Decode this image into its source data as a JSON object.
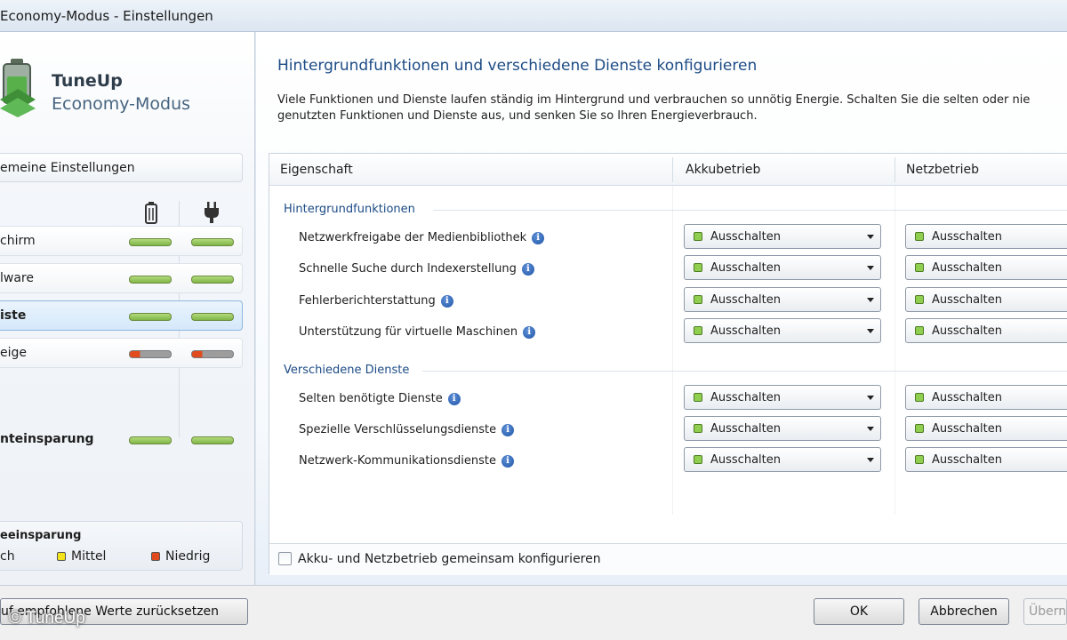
{
  "window": {
    "title": "Economy-Modus - Einstellungen"
  },
  "brand": {
    "name": "TuneUp",
    "subtitle": "Economy-Modus",
    "icon": "battery-logo-icon"
  },
  "sidebar": {
    "header": "emeine Einstellungen",
    "column_icons": [
      "battery-icon",
      "plug-icon"
    ],
    "items": [
      {
        "label": "chirm",
        "battery_level": "high",
        "ac_level": "high",
        "selected": false
      },
      {
        "label": "lware",
        "battery_level": "high",
        "ac_level": "high",
        "selected": false
      },
      {
        "label": "iste",
        "battery_level": "high",
        "ac_level": "high",
        "selected": true
      },
      {
        "label": "eige",
        "battery_level": "low",
        "ac_level": "low",
        "selected": false
      }
    ],
    "summary": {
      "label": "nteinsparung",
      "battery_level": "high",
      "ac_level": "high"
    },
    "legend": {
      "title": "eeinsparung",
      "items": [
        {
          "label": "ch",
          "color": "#7cc242"
        },
        {
          "label": "Mittel",
          "color": "#f2e31b"
        },
        {
          "label": "Niedrig",
          "color": "#e24b1d"
        }
      ]
    }
  },
  "main": {
    "title": "Hintergrundfunktionen und verschiedene Dienste konfigurieren",
    "description": "Viele Funktionen und Dienste laufen ständig im Hintergrund und verbrauchen so unnötig Energie. Schalten Sie die selten oder nie genutzten Funktionen und Dienste aus, und senken Sie so Ihren Energieverbrauch.",
    "columns": [
      "Eigenschaft",
      "Akkubetrieb",
      "Netzbetrieb"
    ],
    "groups": [
      {
        "title": "Hintergrundfunktionen",
        "rows": [
          {
            "label": "Netzwerkfreigabe der Medienbibliothek",
            "battery": "Ausschalten",
            "ac": "Ausschalten"
          },
          {
            "label": "Schnelle Suche durch Indexerstellung",
            "battery": "Ausschalten",
            "ac": "Ausschalten"
          },
          {
            "label": "Fehlerberichterstattung",
            "battery": "Ausschalten",
            "ac": "Ausschalten"
          },
          {
            "label": "Unterstützung für virtuelle Maschinen",
            "battery": "Ausschalten",
            "ac": "Ausschalten"
          }
        ]
      },
      {
        "title": "Verschiedene Dienste",
        "rows": [
          {
            "label": "Selten benötigte Dienste",
            "battery": "Ausschalten",
            "ac": "Ausschalten"
          },
          {
            "label": "Spezielle Verschlüsselungsdienste",
            "battery": "Ausschalten",
            "ac": "Ausschalten"
          },
          {
            "label": "Netzwerk-Kommunikationsdienste",
            "battery": "Ausschalten",
            "ac": "Ausschalten"
          }
        ]
      }
    ],
    "shared_config": {
      "label": "Akku- und Netzbetrieb gemeinsam konfigurieren",
      "checked": false
    }
  },
  "buttons": {
    "reset": "uf empfohlene Werte zurücksetzen",
    "ok": "OK",
    "cancel": "Abbrechen",
    "apply": "Überne"
  },
  "watermark": "© TuneUp"
}
